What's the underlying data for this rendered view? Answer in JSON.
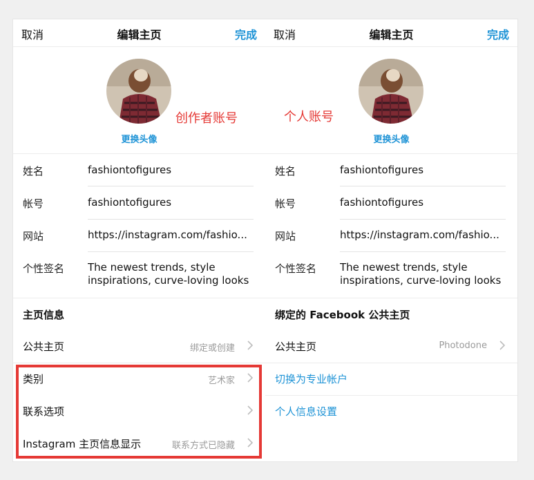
{
  "left": {
    "nav": {
      "cancel": "取消",
      "title": "编辑主页",
      "done": "完成"
    },
    "change_photo": "更换头像",
    "annotation": "创作者账号",
    "fields": [
      {
        "label": "姓名",
        "value": "fashiontofigures"
      },
      {
        "label": "帐号",
        "value": "fashiontofigures"
      },
      {
        "label": "网站",
        "value": "https://instagram.com/fashio..."
      },
      {
        "label": "个性签名",
        "value": "The newest trends, style inspirations, curve-loving looks"
      }
    ],
    "section_title": "主页信息",
    "rows": [
      {
        "label": "公共主页",
        "value": "绑定或创建"
      },
      {
        "label": "类别",
        "value": "艺术家"
      },
      {
        "label": "联系选项",
        "value": ""
      },
      {
        "label": "Instagram 主页信息显示",
        "value": "联系方式已隐藏"
      }
    ]
  },
  "right": {
    "nav": {
      "cancel": "取消",
      "title": "编辑主页",
      "done": "完成"
    },
    "change_photo": "更换头像",
    "annotation": "个人账号",
    "fields": [
      {
        "label": "姓名",
        "value": "fashiontofigures"
      },
      {
        "label": "帐号",
        "value": "fashiontofigures"
      },
      {
        "label": "网站",
        "value": "https://instagram.com/fashio..."
      },
      {
        "label": "个性签名",
        "value": "The newest trends, style inspirations, curve-loving looks"
      }
    ],
    "section_title": "绑定的 Facebook 公共主页",
    "page_row": {
      "label": "公共主页",
      "value": "Photodone"
    },
    "links": [
      "切换为专业帐户",
      "个人信息设置"
    ]
  },
  "colors": {
    "accent": "#1e93d6",
    "annotation": "#e53935",
    "highlight": "#e53935"
  }
}
